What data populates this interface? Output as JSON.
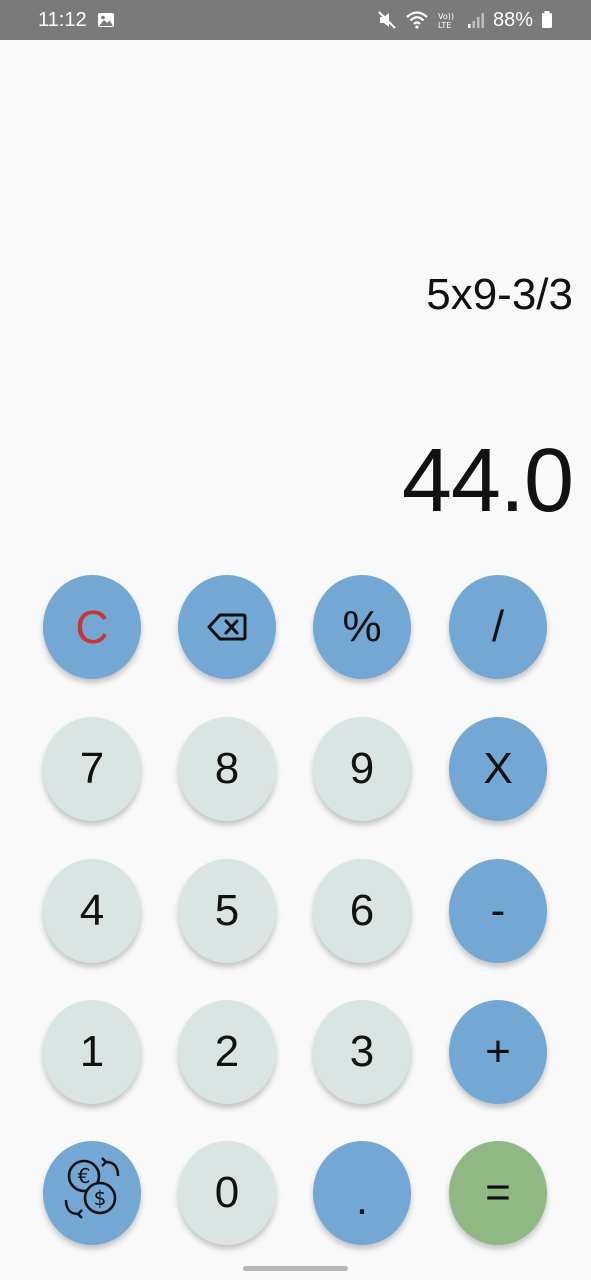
{
  "status_bar": {
    "time": "11:12",
    "battery": "88%",
    "icons": [
      "gallery-icon",
      "mute-icon",
      "wifi-icon",
      "volte-icon",
      "signal-icon",
      "battery-icon"
    ]
  },
  "display": {
    "expression": "5x9-3/3",
    "result": "44.0"
  },
  "keypad": {
    "rows": [
      [
        {
          "label": "C",
          "kind": "clear"
        },
        {
          "label": "",
          "kind": "backspace",
          "icon": "backspace-icon"
        },
        {
          "label": "%",
          "kind": "op"
        },
        {
          "label": "/",
          "kind": "op"
        }
      ],
      [
        {
          "label": "7",
          "kind": "num"
        },
        {
          "label": "8",
          "kind": "num"
        },
        {
          "label": "9",
          "kind": "num"
        },
        {
          "label": "X",
          "kind": "op"
        }
      ],
      [
        {
          "label": "4",
          "kind": "num"
        },
        {
          "label": "5",
          "kind": "num"
        },
        {
          "label": "6",
          "kind": "num"
        },
        {
          "label": "-",
          "kind": "op"
        }
      ],
      [
        {
          "label": "1",
          "kind": "num"
        },
        {
          "label": "2",
          "kind": "num"
        },
        {
          "label": "3",
          "kind": "num"
        },
        {
          "label": "+",
          "kind": "op"
        }
      ],
      [
        {
          "label": "",
          "kind": "currency",
          "icon": "currency-exchange-icon"
        },
        {
          "label": "0",
          "kind": "num"
        },
        {
          "label": ".",
          "kind": "op"
        },
        {
          "label": "=",
          "kind": "eq"
        }
      ]
    ]
  },
  "colors": {
    "operator_key": "#72a8d3",
    "number_key": "#d9e4e3",
    "equals_key": "#8fb882",
    "clear_text": "#cc3333",
    "status_bar": "#7a7a7a"
  }
}
